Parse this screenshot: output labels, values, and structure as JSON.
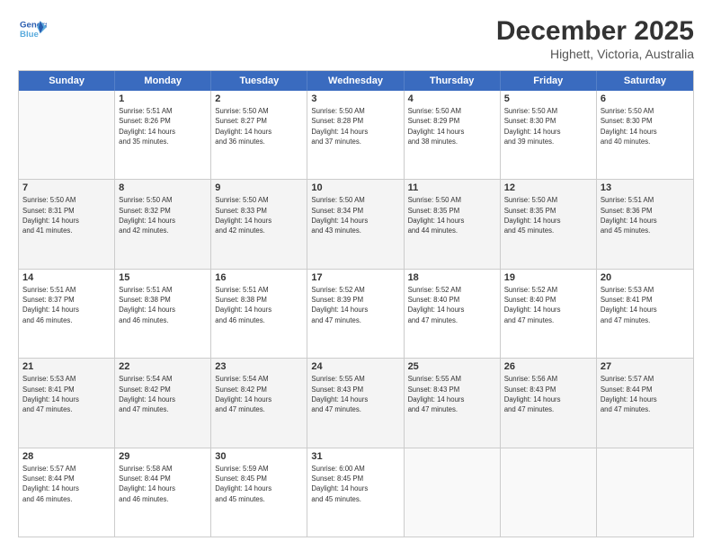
{
  "logo": {
    "line1": "General",
    "line2": "Blue"
  },
  "title": "December 2025",
  "location": "Highett, Victoria, Australia",
  "weekdays": [
    "Sunday",
    "Monday",
    "Tuesday",
    "Wednesday",
    "Thursday",
    "Friday",
    "Saturday"
  ],
  "rows": [
    [
      {
        "day": "",
        "info": ""
      },
      {
        "day": "1",
        "info": "Sunrise: 5:51 AM\nSunset: 8:26 PM\nDaylight: 14 hours\nand 35 minutes."
      },
      {
        "day": "2",
        "info": "Sunrise: 5:50 AM\nSunset: 8:27 PM\nDaylight: 14 hours\nand 36 minutes."
      },
      {
        "day": "3",
        "info": "Sunrise: 5:50 AM\nSunset: 8:28 PM\nDaylight: 14 hours\nand 37 minutes."
      },
      {
        "day": "4",
        "info": "Sunrise: 5:50 AM\nSunset: 8:29 PM\nDaylight: 14 hours\nand 38 minutes."
      },
      {
        "day": "5",
        "info": "Sunrise: 5:50 AM\nSunset: 8:30 PM\nDaylight: 14 hours\nand 39 minutes."
      },
      {
        "day": "6",
        "info": "Sunrise: 5:50 AM\nSunset: 8:30 PM\nDaylight: 14 hours\nand 40 minutes."
      }
    ],
    [
      {
        "day": "7",
        "info": "Sunrise: 5:50 AM\nSunset: 8:31 PM\nDaylight: 14 hours\nand 41 minutes."
      },
      {
        "day": "8",
        "info": "Sunrise: 5:50 AM\nSunset: 8:32 PM\nDaylight: 14 hours\nand 42 minutes."
      },
      {
        "day": "9",
        "info": "Sunrise: 5:50 AM\nSunset: 8:33 PM\nDaylight: 14 hours\nand 42 minutes."
      },
      {
        "day": "10",
        "info": "Sunrise: 5:50 AM\nSunset: 8:34 PM\nDaylight: 14 hours\nand 43 minutes."
      },
      {
        "day": "11",
        "info": "Sunrise: 5:50 AM\nSunset: 8:35 PM\nDaylight: 14 hours\nand 44 minutes."
      },
      {
        "day": "12",
        "info": "Sunrise: 5:50 AM\nSunset: 8:35 PM\nDaylight: 14 hours\nand 45 minutes."
      },
      {
        "day": "13",
        "info": "Sunrise: 5:51 AM\nSunset: 8:36 PM\nDaylight: 14 hours\nand 45 minutes."
      }
    ],
    [
      {
        "day": "14",
        "info": "Sunrise: 5:51 AM\nSunset: 8:37 PM\nDaylight: 14 hours\nand 46 minutes."
      },
      {
        "day": "15",
        "info": "Sunrise: 5:51 AM\nSunset: 8:38 PM\nDaylight: 14 hours\nand 46 minutes."
      },
      {
        "day": "16",
        "info": "Sunrise: 5:51 AM\nSunset: 8:38 PM\nDaylight: 14 hours\nand 46 minutes."
      },
      {
        "day": "17",
        "info": "Sunrise: 5:52 AM\nSunset: 8:39 PM\nDaylight: 14 hours\nand 47 minutes."
      },
      {
        "day": "18",
        "info": "Sunrise: 5:52 AM\nSunset: 8:40 PM\nDaylight: 14 hours\nand 47 minutes."
      },
      {
        "day": "19",
        "info": "Sunrise: 5:52 AM\nSunset: 8:40 PM\nDaylight: 14 hours\nand 47 minutes."
      },
      {
        "day": "20",
        "info": "Sunrise: 5:53 AM\nSunset: 8:41 PM\nDaylight: 14 hours\nand 47 minutes."
      }
    ],
    [
      {
        "day": "21",
        "info": "Sunrise: 5:53 AM\nSunset: 8:41 PM\nDaylight: 14 hours\nand 47 minutes."
      },
      {
        "day": "22",
        "info": "Sunrise: 5:54 AM\nSunset: 8:42 PM\nDaylight: 14 hours\nand 47 minutes."
      },
      {
        "day": "23",
        "info": "Sunrise: 5:54 AM\nSunset: 8:42 PM\nDaylight: 14 hours\nand 47 minutes."
      },
      {
        "day": "24",
        "info": "Sunrise: 5:55 AM\nSunset: 8:43 PM\nDaylight: 14 hours\nand 47 minutes."
      },
      {
        "day": "25",
        "info": "Sunrise: 5:55 AM\nSunset: 8:43 PM\nDaylight: 14 hours\nand 47 minutes."
      },
      {
        "day": "26",
        "info": "Sunrise: 5:56 AM\nSunset: 8:43 PM\nDaylight: 14 hours\nand 47 minutes."
      },
      {
        "day": "27",
        "info": "Sunrise: 5:57 AM\nSunset: 8:44 PM\nDaylight: 14 hours\nand 47 minutes."
      }
    ],
    [
      {
        "day": "28",
        "info": "Sunrise: 5:57 AM\nSunset: 8:44 PM\nDaylight: 14 hours\nand 46 minutes."
      },
      {
        "day": "29",
        "info": "Sunrise: 5:58 AM\nSunset: 8:44 PM\nDaylight: 14 hours\nand 46 minutes."
      },
      {
        "day": "30",
        "info": "Sunrise: 5:59 AM\nSunset: 8:45 PM\nDaylight: 14 hours\nand 45 minutes."
      },
      {
        "day": "31",
        "info": "Sunrise: 6:00 AM\nSunset: 8:45 PM\nDaylight: 14 hours\nand 45 minutes."
      },
      {
        "day": "",
        "info": ""
      },
      {
        "day": "",
        "info": ""
      },
      {
        "day": "",
        "info": ""
      }
    ]
  ]
}
